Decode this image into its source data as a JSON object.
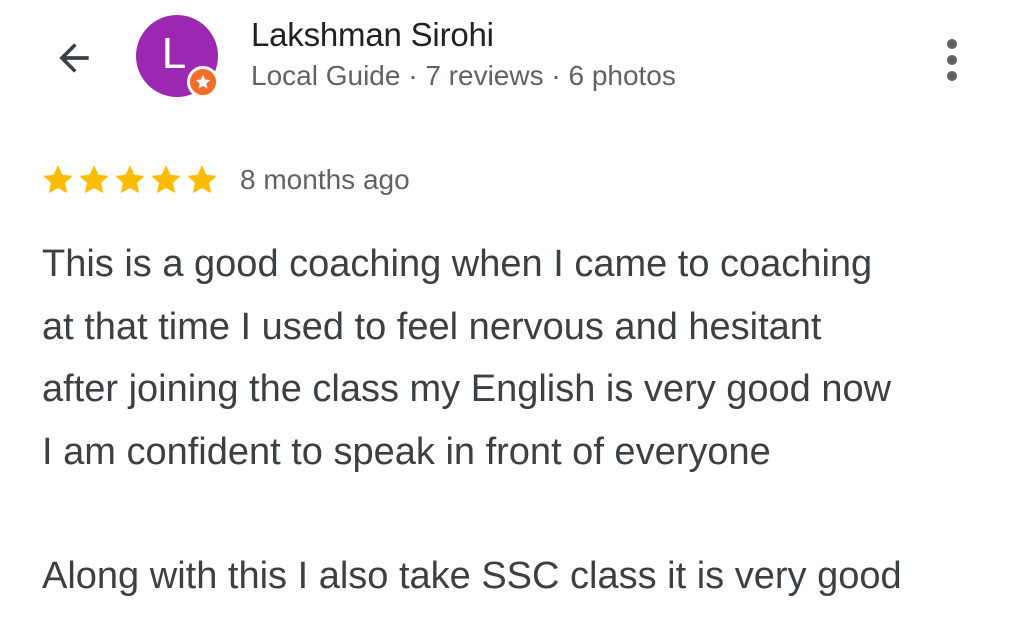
{
  "header": {
    "back_icon": "arrow-back-icon",
    "avatar_letter": "L",
    "avatar_color": "#9c27b0",
    "badge_icon": "local-guide-star-icon",
    "badge_color": "#f26c2b",
    "reviewer_name": "Lakshman Sirohi",
    "reviewer_meta": "Local Guide · 7 reviews · 6 photos",
    "more_icon": "more-vert-icon"
  },
  "review": {
    "rating": 5,
    "rating_max": 5,
    "star_color": "#fbbc04",
    "date": "8 months ago",
    "paragraphs": [
      "This is a good coaching when I came to coaching\nat that time I used to feel nervous and hesitant\nafter joining the class my English is very good now\nI am confident to speak in front of everyone",
      "Along with this I also take SSC class it is very good"
    ]
  }
}
